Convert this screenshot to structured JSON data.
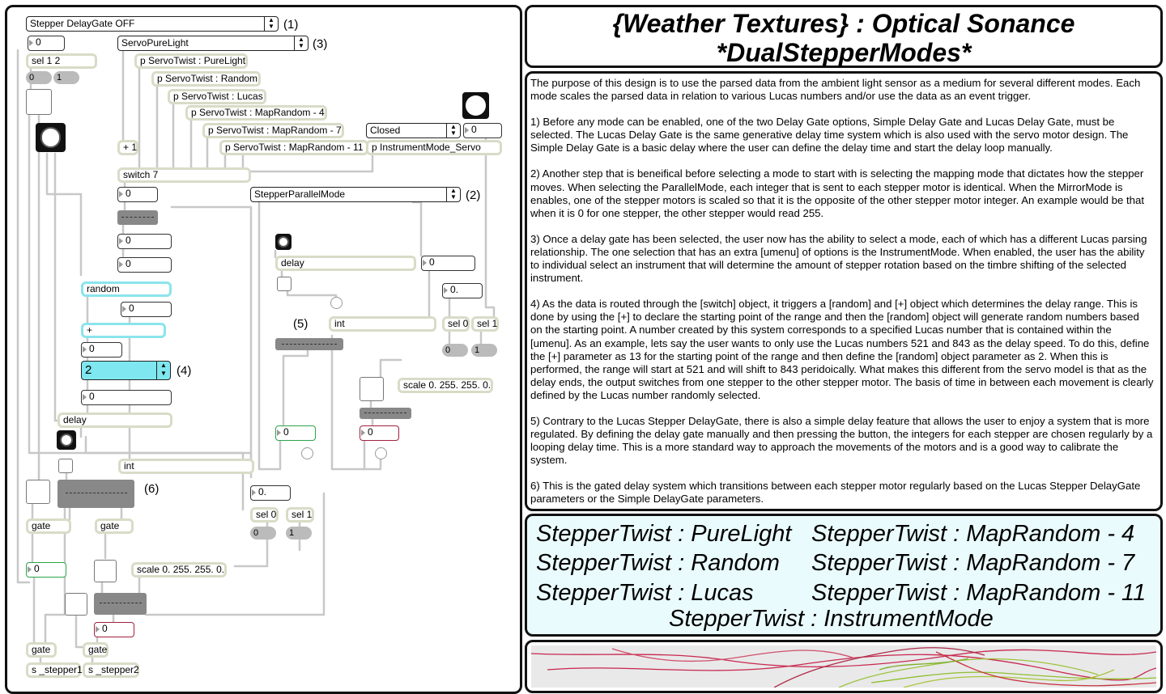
{
  "title": {
    "line1": "{Weather Textures} : Optical Sonance",
    "line2": "*DualStepperModes*"
  },
  "description": [
    "The purpose of this design is to use the parsed data from the ambient light sensor as a medium for several different modes. Each mode scales the parsed data in relation to various Lucas numbers and/or use the data as an event trigger.",
    "1) Before any mode can be enabled, one of the two Delay Gate options, Simple Delay Gate and Lucas Delay Gate, must be selected. The Lucas Delay Gate is the same generative delay time system which is also used with the servo motor design. The Simple Delay Gate is a basic delay where the user can define the delay time and start the delay loop manually.",
    "2) Another step that is beneifical before selecting a mode to start with is selecting the mapping mode that dictates how the stepper moves. When selecting the ParallelMode, each integer that is sent to each stepper motor is identical. When the MirrorMode is enables, one of the stepper motors is scaled so that it is the opposite of the other stepper motor integer. An example would be that when it is 0 for one stepper, the other stepper would read 255.",
    "3) Once a delay gate has been selected, the user now has the ability to select a mode, each of which has a different Lucas parsing relationship. The one selection that has an extra [umenu] of options is the InstrumentMode. When enabled, the user has the ability to individual select an instrument that will determine the amount of stepper rotation based on the timbre shifting of the selected instrument.",
    "4) As the data is routed through the [switch] object, it triggers a [random] and [+] object which determines the delay range. This is done by using the [+] to declare the starting point of the range and then the [random] object will generate random numbers based on the starting point. A number created by this system corresponds to a specified Lucas number that is contained within the [umenu]. As an example, lets say the user wants to only use the Lucas numbers 521 and 843 as the delay speed. To do this, define the [+] parameter as 13 for the starting point of the range and then define the [random] object parameter as 2. When this is performed, the range will start at 521 and will shift to 843 peridoically. What makes this different from the servo model is that as the delay ends, the output switches from one stepper to the other stepper motor. The basis of time in between each movement is clearly defined by the Lucas number randomly selected.",
    "5) Contrary to the Lucas Stepper DelayGate, there is also a simple delay feature that allows the user to enjoy a system that is more regulated. By defining the delay gate manually and then pressing the button, the integers for each stepper are chosen regularly by a looping delay time. This is a more standard way to approach the movements of the motors and is a good way to calibrate the system.",
    "6) This is the gated delay system which transitions between each stepper motor regularly based on the Lucas Stepper DelayGate parameters or the Simple DelayGate parameters."
  ],
  "modes": [
    "StepperTwist : PureLight",
    "StepperTwist : MapRandom - 4",
    "StepperTwist : Random",
    "StepperTwist : MapRandom - 7",
    "StepperTwist : Lucas",
    "StepperTwist : MapRandom - 11",
    "StepperTwist : InstrumentMode"
  ],
  "patch": {
    "menus": {
      "delaygate": "Stepper DelayGate OFF",
      "servo": "ServoPureLight",
      "mapping": "StepperParallelMode",
      "closed": "Closed",
      "lucas": "2"
    },
    "labels": {
      "l1": "(1)",
      "l2": "(2)",
      "l3": "(3)",
      "l4": "(4)",
      "l5": "(5)",
      "l6": "(6)"
    },
    "objects": {
      "sel12": "sel 1 2",
      "pure": "p ServoTwist : PureLight",
      "random_p": "p ServoTwist : Random",
      "lucas_p": "p ServoTwist : Lucas",
      "map4": "p ServoTwist : MapRandom - 4",
      "map7": "p ServoTwist : MapRandom - 7",
      "map11": "p ServoTwist : MapRandom - 11",
      "instr": "p InstrumentMode_Servo",
      "plus1": "+ 1",
      "switch7": "switch 7",
      "random": "random",
      "plus": "+",
      "delay1": "delay",
      "delay2": "delay",
      "int1": "int",
      "int2": "int",
      "sel0a": "sel 0",
      "sel1a": "sel 1",
      "sel0b": "sel 0",
      "sel1b": "sel 1",
      "scale1": "scale 0. 255. 255. 0.",
      "scale2": "scale 0. 255. 255. 0.",
      "gate1": "gate",
      "gate2": "gate",
      "gate3": "gate",
      "gate4": "gate",
      "send1": "s _stepper1",
      "send2": "s _stepper2"
    },
    "pills": {
      "p0a": "0",
      "p1a": "1",
      "p0b": "0",
      "p1b": "1",
      "p0c": "0",
      "p1c": "1"
    },
    "numbers": {
      "n_top": "0",
      "n_sw": "0",
      "n_a": "0",
      "n_b": "0",
      "n_rand": "0",
      "n_plus": "0",
      "n_lucas": "0",
      "n_dial": "0",
      "n_delay": "0",
      "n_float1": "0.",
      "n_float2": "0.",
      "n_green1": "0",
      "n_red1": "0",
      "n_green2": "0",
      "n_red2": "0"
    }
  }
}
